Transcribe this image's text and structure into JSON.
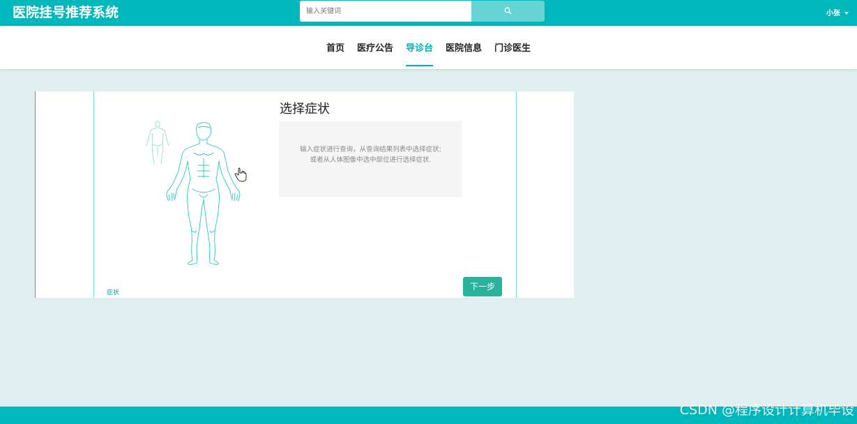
{
  "header": {
    "brand": "医院挂号推荐系统",
    "search_placeholder": "输入关键词",
    "search_icon": "search-icon",
    "username": "小张",
    "user_caret_icon": "caret-down-icon"
  },
  "nav": {
    "items": [
      {
        "label": "首页",
        "active": false
      },
      {
        "label": "医疗公告",
        "active": false
      },
      {
        "label": "导诊台",
        "active": true
      },
      {
        "label": "医院信息",
        "active": false
      },
      {
        "label": "门诊医生",
        "active": false
      }
    ]
  },
  "panel": {
    "title": "选择症状",
    "hint_line1": "输入症状进行查询，从查询结果列表中选择症状;",
    "hint_line2": "或者从人体图像中选中部位进行选择症状.",
    "body_icon": "human-body-icon",
    "back_view_icon": "human-body-back-icon",
    "cursor_icon": "hand-pointer-icon",
    "symptom_link": "症状",
    "next_label": "下一步"
  },
  "footer": {
    "watermark": "CSDN @程序设计计算机毕设"
  },
  "colors": {
    "brand": "#00b7bc",
    "accent": "#00b1b6",
    "button": "#2ab39c",
    "background": "#dfeeee"
  }
}
